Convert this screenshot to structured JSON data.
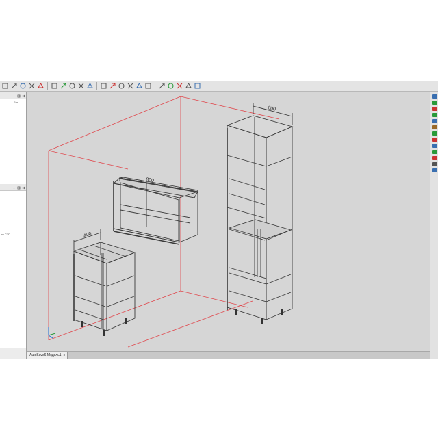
{
  "colors": {
    "viewport_bg": "#d6d6d6",
    "room_lines": "#e0474c",
    "cabinet_lines": "#3a3a3a",
    "accent_blue": "#1e6fd6",
    "accent_green": "#2a9a3a"
  },
  "left_panel": {
    "top_label": "Fon",
    "bottom_label": "жо С3D"
  },
  "document_tab": {
    "title": "AutoSave6 Модель1",
    "close_glyph": "x"
  },
  "dimensions": {
    "wall_cabinet_width": "800",
    "base_cabinet_width": "400",
    "tall_cabinet_width": "600"
  },
  "toolbar_icons": [
    "cursor-icon",
    "pan-icon",
    "rotate-icon",
    "zoom-icon",
    "zoom-box-icon",
    "select-icon",
    "layer-icon",
    "grid-icon",
    "snap-icon",
    "copy-icon",
    "move-icon",
    "delete-icon",
    "measure-icon",
    "align-icon",
    "mirror-icon",
    "array-icon",
    "group-icon",
    "ungroup-icon",
    "render-icon",
    "settings-icon",
    "help-icon"
  ],
  "right_toolbar_icons": [
    "panel-icon",
    "shelf-icon",
    "door-icon",
    "drawer-icon",
    "handle-icon",
    "leg-icon",
    "hinge-icon",
    "material-icon",
    "texture-icon",
    "color-icon",
    "light-icon",
    "camera-icon",
    "export-icon"
  ]
}
